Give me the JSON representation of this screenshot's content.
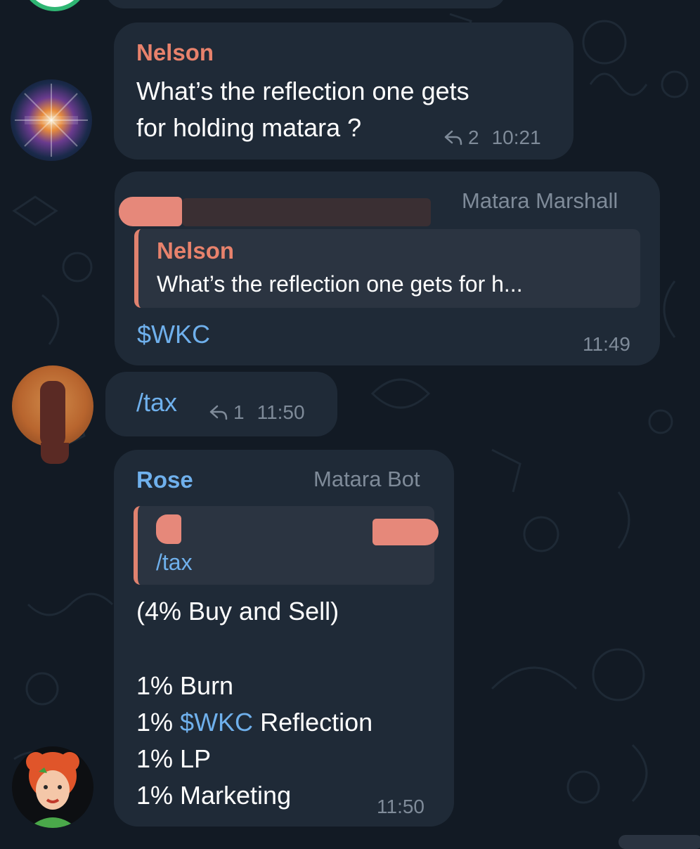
{
  "colors": {
    "background": "#121a24",
    "bubble": "#1f2a37",
    "quote_bg": "#2b3441",
    "nelson_name": "#e8826c",
    "rose_name": "#6fb0ec",
    "link": "#6fb0ec",
    "meta": "#7f8b99"
  },
  "messages": [
    {
      "sender": "Nelson",
      "text_line1": "What’s the reflection one gets",
      "text_line2": "for holding matara ?",
      "reply_icon": "reply-arrow-icon",
      "reply_count": "2",
      "time": "10:21"
    },
    {
      "role": "Matara Marshall",
      "quote_sender": "Nelson",
      "quote_text": "What’s the reflection one gets for h...",
      "text": "$WKC",
      "time": "11:49"
    },
    {
      "text": "/tax",
      "reply_icon": "reply-arrow-icon",
      "reply_count": "1",
      "time": "11:50"
    },
    {
      "sender": "Rose",
      "role": "Matara Bot",
      "quote_text": "/tax",
      "line1": "(4% Buy and Sell)",
      "line2": "1% Burn",
      "line3_prefix": "1% ",
      "line3_link": "$WKC",
      "line3_suffix": " Reflection",
      "line4": "1% LP",
      "line5": "1% Marketing",
      "time": "11:50"
    }
  ]
}
